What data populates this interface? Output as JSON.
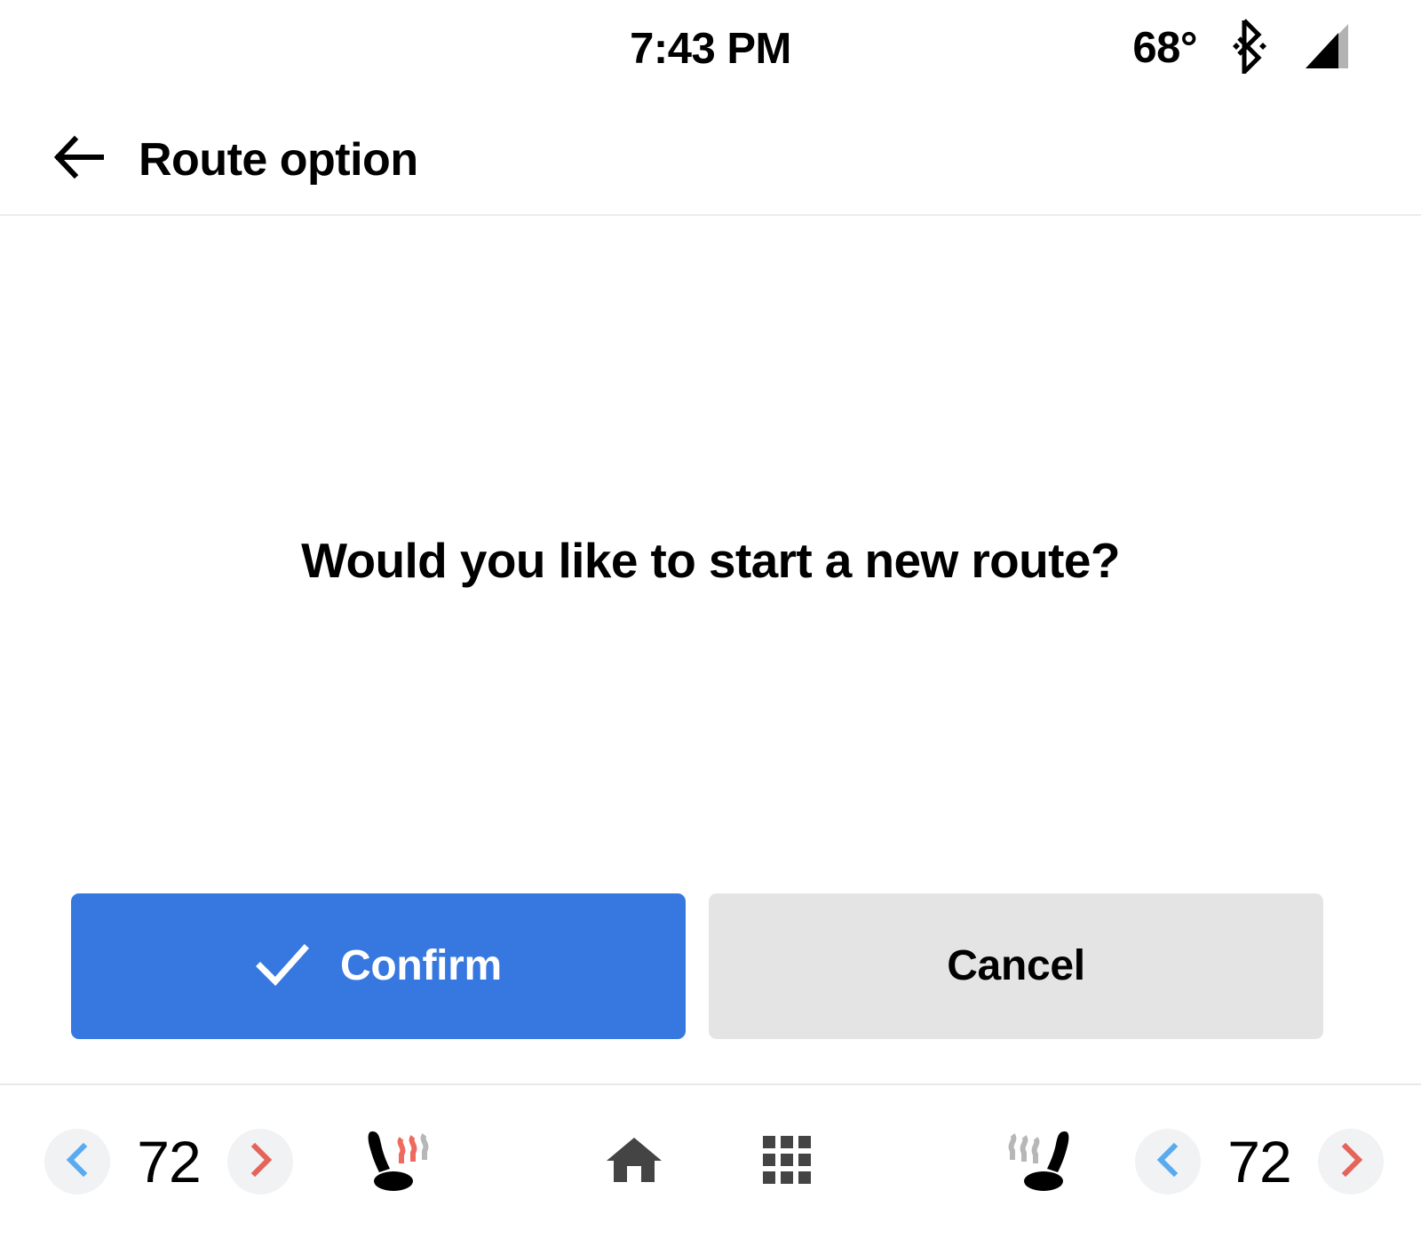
{
  "status_bar": {
    "time": "7:43 PM",
    "temperature": "68°",
    "bluetooth_icon": "bluetooth-icon",
    "signal_icon": "cellular-signal-icon"
  },
  "header": {
    "back_icon": "back-arrow-icon",
    "title": "Route option"
  },
  "main": {
    "prompt": "Would you like to start a new route?",
    "confirm_label": "Confirm",
    "confirm_icon": "check-icon",
    "cancel_label": "Cancel"
  },
  "bottom_bar": {
    "driver_climate": {
      "decrease_icon": "chevron-left-icon",
      "temperature": "72",
      "increase_icon": "chevron-right-icon"
    },
    "passenger_climate": {
      "decrease_icon": "chevron-left-icon",
      "temperature": "72",
      "increase_icon": "chevron-right-icon"
    },
    "driver_seat_heater_icon": "heated-seat-icon",
    "passenger_seat_heater_icon": "heated-seat-icon",
    "home_icon": "home-icon",
    "apps_icon": "apps-grid-icon"
  },
  "colors": {
    "accent_blue": "#3778e0",
    "chevron_blue": "#5aaaf0",
    "chevron_red": "#e4645a",
    "cancel_gray": "#e4e4e4",
    "circle_gray": "#f1f2f4",
    "nav_icon_gray": "#444444",
    "heat_active": "#ef6a5e",
    "heat_inactive": "#b7b7b7"
  }
}
